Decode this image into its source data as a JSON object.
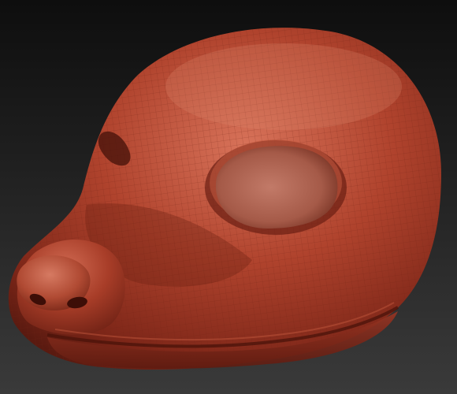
{
  "scene": {
    "subject": "sculpted-creature-head",
    "colors": {
      "background_top": "#0e0e0e",
      "background_bottom": "#3a3a3a",
      "clay_base": "#b0432d",
      "clay_highlight": "#d8735a",
      "clay_shadow": "#5a1a10",
      "wireframe": "#7a2a1c"
    }
  }
}
